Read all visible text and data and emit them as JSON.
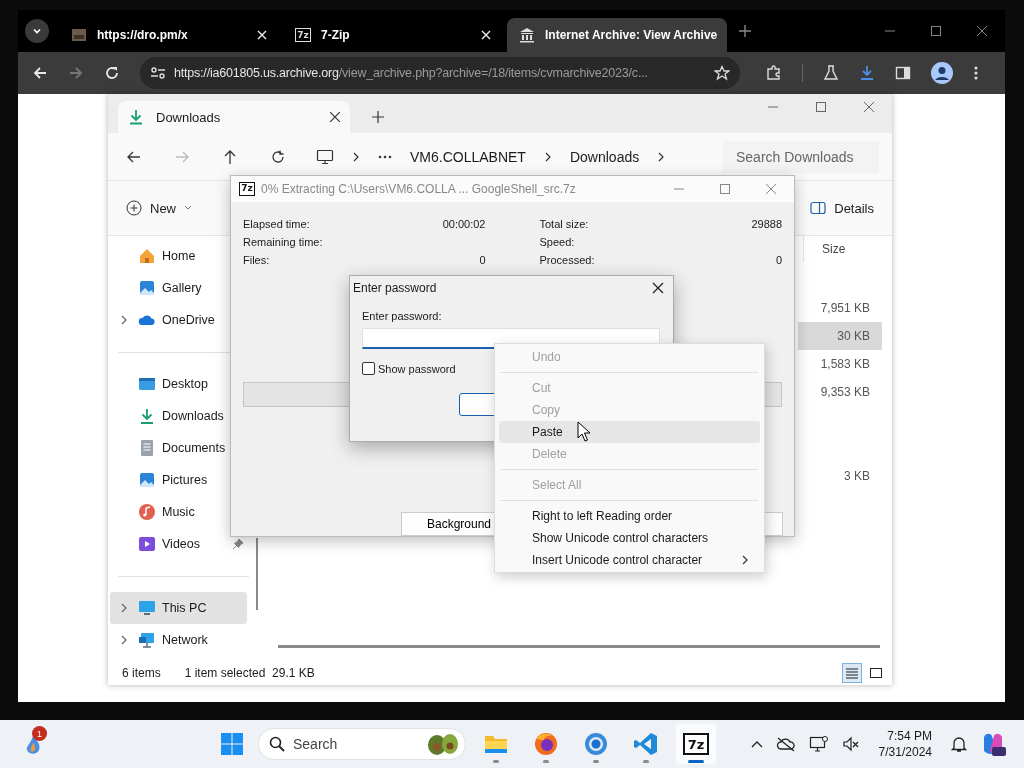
{
  "browser": {
    "tabs": [
      {
        "title": "https://dro.pm/x",
        "selected": false
      },
      {
        "title": "7-Zip",
        "icon_text": "7z",
        "selected": false
      },
      {
        "title": "Internet Archive: View Archive",
        "selected": true
      }
    ],
    "url": {
      "host": "https://ia601805.us.archive.org",
      "path": "/view_archive.php?archive=/18/items/cvmarchive2023/c..."
    }
  },
  "explorer": {
    "tab": "Downloads",
    "breadcrumb": [
      "VM6.COLLABNET",
      "Downloads"
    ],
    "search_placeholder": "Search Downloads",
    "new_label": "New",
    "details_label": "Details",
    "size_header": "Size",
    "sidebar": [
      {
        "items": [
          {
            "label": "Home",
            "expandable": false,
            "selected": false
          },
          {
            "label": "Gallery",
            "expandable": false,
            "selected": false
          },
          {
            "label": "OneDrive",
            "expandable": true,
            "selected": false
          }
        ]
      },
      {
        "items": [
          {
            "label": "Desktop",
            "expandable": false,
            "selected": false
          },
          {
            "label": "Downloads",
            "expandable": false,
            "selected": false
          },
          {
            "label": "Documents",
            "expandable": false,
            "selected": false
          },
          {
            "label": "Pictures",
            "expandable": false,
            "selected": false
          },
          {
            "label": "Music",
            "expandable": false,
            "selected": false
          },
          {
            "label": "Videos",
            "expandable": false,
            "pinned": true,
            "selected": false
          }
        ]
      },
      {
        "items": [
          {
            "label": "This PC",
            "expandable": true,
            "selected": true
          },
          {
            "label": "Network",
            "expandable": true,
            "selected": false
          }
        ]
      }
    ],
    "files": [
      {
        "size": "7,951 KB",
        "selected": false
      },
      {
        "size": "30 KB",
        "selected": true
      },
      {
        "size": "1,583 KB",
        "selected": false
      },
      {
        "size": "9,353 KB",
        "selected": false
      },
      {
        "size": "3 KB",
        "selected": false
      }
    ],
    "views": [
      {
        "kind": "details",
        "selected": true
      },
      {
        "kind": "tiles",
        "selected": false
      }
    ],
    "status": {
      "count": "6 items",
      "selection": "1 item selected  29.1 KB"
    }
  },
  "sevenzip": {
    "icon_text": "7z",
    "title": "0% Extracting C:\\Users\\VM6.COLLA ... GoogleShell_src.7z",
    "left_stats": [
      {
        "label": "Elapsed time:",
        "value": "00:00:02"
      },
      {
        "label": "Remaining time:"
      },
      {
        "label": "Files:",
        "value": "0"
      }
    ],
    "right_stats": [
      {
        "label": "Total size:",
        "value": "29888"
      },
      {
        "label": "Speed:"
      },
      {
        "label": "Processed:",
        "value": "0"
      }
    ],
    "progress": {
      "level": 0
    },
    "buttons": [
      "Background"
    ]
  },
  "password": {
    "title": "Enter password",
    "label": "Enter password:",
    "show_password": {
      "label": "Show password",
      "checked": false
    }
  },
  "context_menu": {
    "items": [
      {
        "kind": "item",
        "label": "Undo",
        "disabled": true,
        "highlighted": false,
        "submenu": false
      },
      {
        "kind": "separator"
      },
      {
        "kind": "item",
        "label": "Cut",
        "disabled": true,
        "highlighted": false,
        "submenu": false
      },
      {
        "kind": "item",
        "label": "Copy",
        "disabled": true,
        "highlighted": false,
        "submenu": false
      },
      {
        "kind": "item",
        "label": "Paste",
        "disabled": false,
        "highlighted": true,
        "submenu": false
      },
      {
        "kind": "item",
        "label": "Delete",
        "disabled": true,
        "highlighted": false,
        "submenu": false
      },
      {
        "kind": "separator"
      },
      {
        "kind": "item",
        "label": "Select All",
        "disabled": true,
        "highlighted": false,
        "submenu": false
      },
      {
        "kind": "separator"
      },
      {
        "kind": "item",
        "label": "Right to left Reading order",
        "disabled": false,
        "highlighted": false,
        "submenu": false
      },
      {
        "kind": "item",
        "label": "Show Unicode control characters",
        "disabled": false,
        "highlighted": false,
        "submenu": false
      },
      {
        "kind": "item",
        "label": "Insert Unicode control character",
        "disabled": false,
        "highlighted": false,
        "submenu": true
      }
    ]
  },
  "taskbar": {
    "notification_badge": "1",
    "search_placeholder": "Search",
    "apps": [
      {
        "kind": "folder",
        "active": false
      },
      {
        "kind": "firefox",
        "active": false
      },
      {
        "kind": "chrome",
        "active": false
      },
      {
        "kind": "code",
        "active": false
      },
      {
        "kind": "label",
        "icon_text": "7z",
        "active": true
      }
    ],
    "time": "7:54 PM",
    "date": "7/31/2024"
  }
}
